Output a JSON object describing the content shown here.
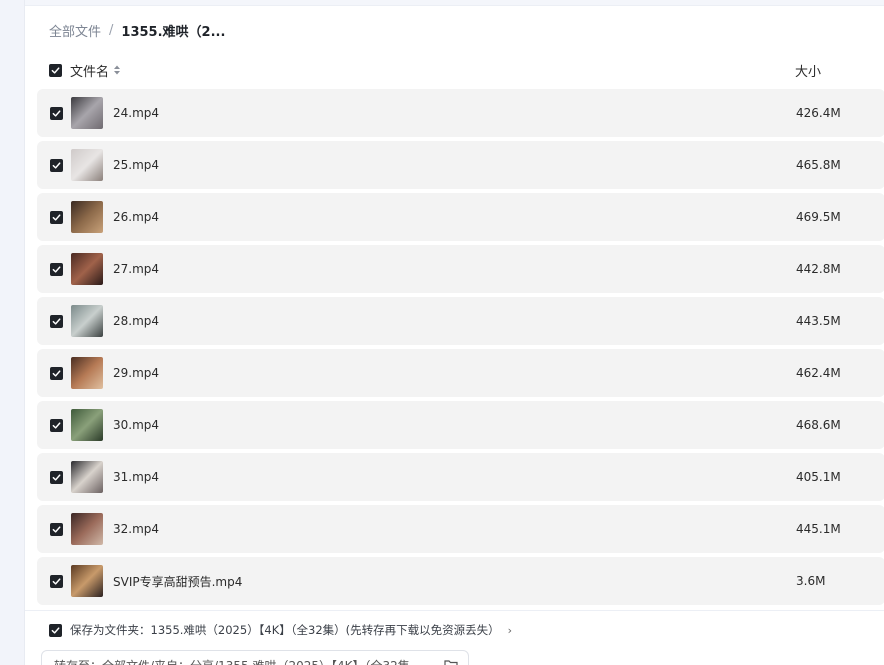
{
  "breadcrumb": {
    "root": "全部文件",
    "separator": "/",
    "current": "1355.难哄（2..."
  },
  "header": {
    "name_label": "文件名",
    "size_label": "大小"
  },
  "files": [
    {
      "name": "24.mp4",
      "size": "426.4M",
      "thumb": [
        "#3b3a3f",
        "#a8a5ab",
        "#6f6a70"
      ]
    },
    {
      "name": "25.mp4",
      "size": "465.8M",
      "thumb": [
        "#cfcac9",
        "#e8e5e4",
        "#8a7f7a"
      ]
    },
    {
      "name": "26.mp4",
      "size": "469.5M",
      "thumb": [
        "#3a2a22",
        "#8d6a4a",
        "#c9a27a"
      ]
    },
    {
      "name": "27.mp4",
      "size": "442.8M",
      "thumb": [
        "#4a2a22",
        "#a0624a",
        "#2a1a18"
      ]
    },
    {
      "name": "28.mp4",
      "size": "443.5M",
      "thumb": [
        "#7b8a8a",
        "#c8cfcd",
        "#3a4040"
      ]
    },
    {
      "name": "29.mp4",
      "size": "462.4M",
      "thumb": [
        "#4a2e22",
        "#b67a55",
        "#e0c0a0"
      ]
    },
    {
      "name": "30.mp4",
      "size": "468.6M",
      "thumb": [
        "#3e5a3a",
        "#8aa07a",
        "#2a3a28"
      ]
    },
    {
      "name": "31.mp4",
      "size": "405.1M",
      "thumb": [
        "#2a2a2e",
        "#d8d2cc",
        "#6a6060"
      ]
    },
    {
      "name": "32.mp4",
      "size": "445.1M",
      "thumb": [
        "#3a2624",
        "#9a6a5a",
        "#d0b8a8"
      ]
    },
    {
      "name": "SVIP专享高甜预告.mp4",
      "size": "3.6M",
      "thumb": [
        "#5a3a22",
        "#c89a6a",
        "#2a2020"
      ]
    }
  ],
  "save_option": {
    "text": "保存为文件夹：1355.难哄（2025）【4K】（全32集）(先转存再下载以免资源丢失）",
    "chevron": "›"
  },
  "destination": {
    "text": "转存至：全部文件/来自：分享/1355.难哄（2025）【4K】（全32集..."
  },
  "colors": {
    "checkbox": "#1f2329",
    "row_bg": "#f3f3f3",
    "panel_bg": "#ffffff"
  }
}
